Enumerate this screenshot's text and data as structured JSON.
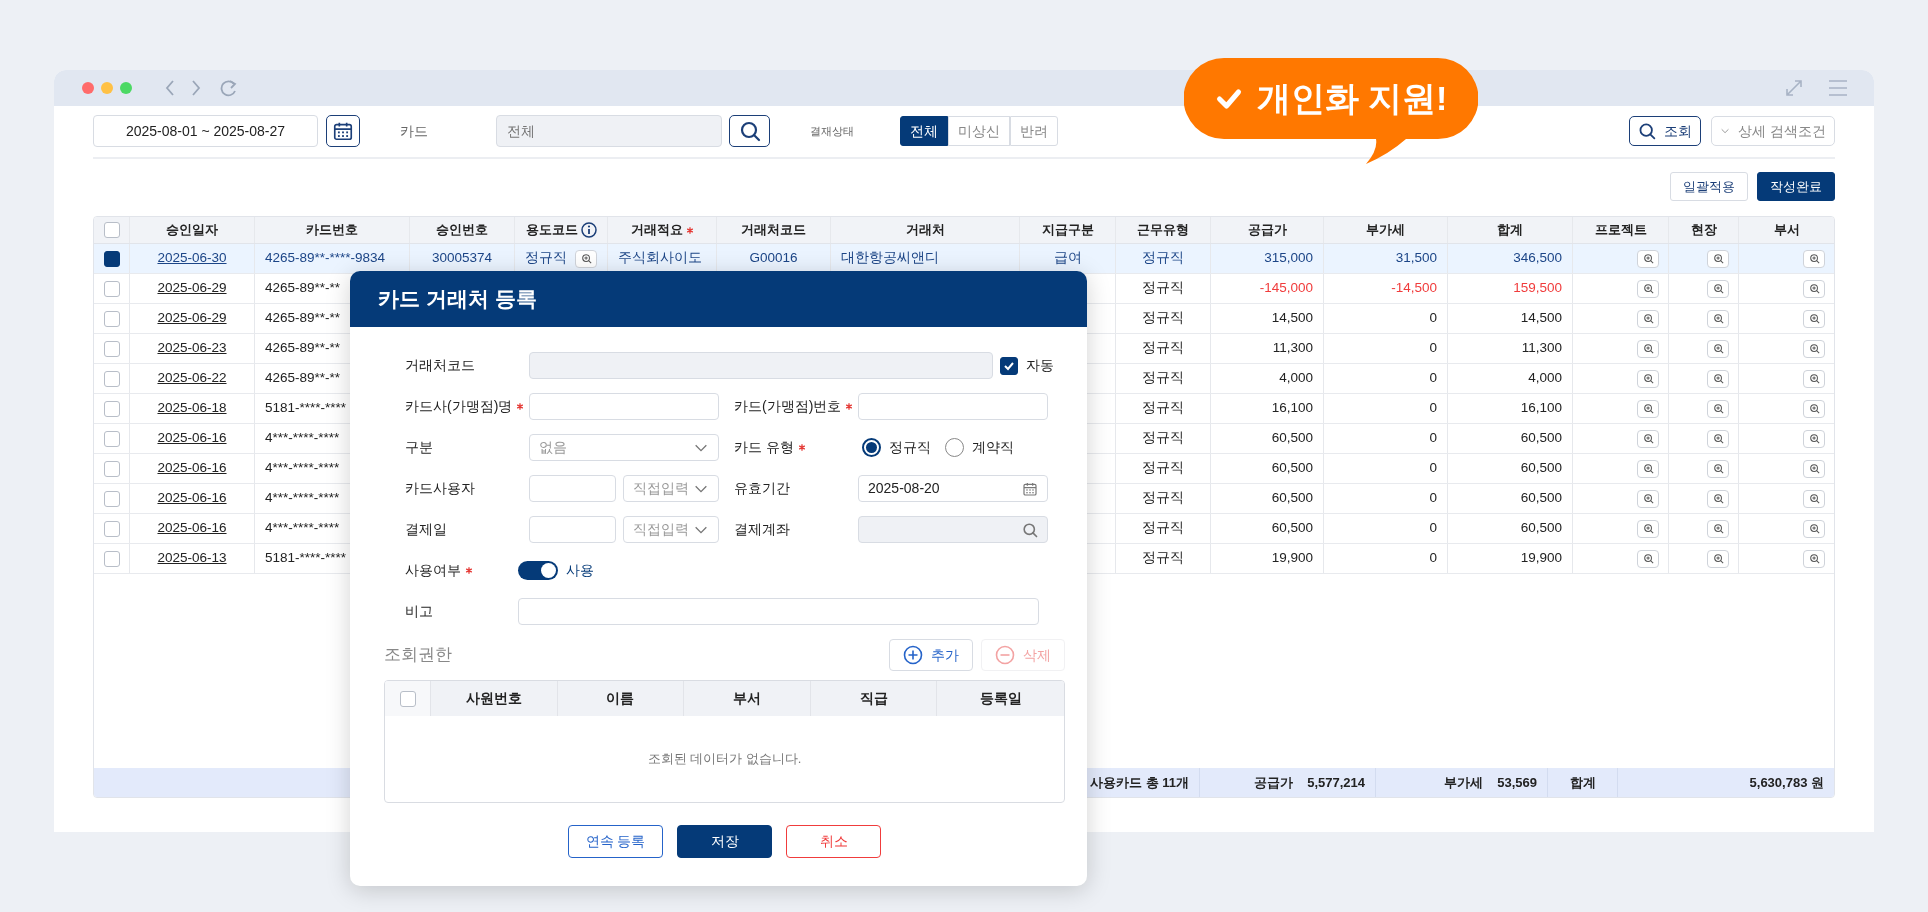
{
  "badge": {
    "text": "개인화 지원!"
  },
  "toolbar": {
    "date_range": "2025-08-01 ~ 2025-08-27",
    "card_label": "카드",
    "card_placeholder": "전체",
    "status_label": "결재상태",
    "status_options": [
      {
        "label": "전체",
        "selected": true
      },
      {
        "label": "미상신",
        "selected": false
      },
      {
        "label": "반려",
        "selected": false
      }
    ],
    "search_button": "조회",
    "detail_button": "상세 검색조건"
  },
  "actions": [
    {
      "label": "일괄적용",
      "kind": "outline"
    },
    {
      "label": "작성완료",
      "kind": "primary"
    }
  ],
  "table": {
    "header_checked": false,
    "columns": [
      {
        "label": "승인일자",
        "kind": "plain"
      },
      {
        "label": "카드번호",
        "kind": "plain"
      },
      {
        "label": "승인번호",
        "kind": "plain"
      },
      {
        "label": "용도코드",
        "kind": "info"
      },
      {
        "label": "거래적요",
        "kind": "required"
      },
      {
        "label": "거래처코드",
        "kind": "plain"
      },
      {
        "label": "거래처",
        "kind": "plain"
      },
      {
        "label": "지급구분",
        "kind": "plain"
      },
      {
        "label": "근무유형",
        "kind": "plain"
      },
      {
        "label": "공급가",
        "kind": "plain"
      },
      {
        "label": "부가세",
        "kind": "plain"
      },
      {
        "label": "합계",
        "kind": "plain"
      },
      {
        "label": "프로젝트",
        "kind": "plain"
      },
      {
        "label": "현장",
        "kind": "plain"
      },
      {
        "label": "부서",
        "kind": "plain"
      }
    ],
    "rows": [
      {
        "checked": true,
        "negative": false,
        "date": "2025-06-30",
        "card": "4265-89**-****-9834",
        "approval": "30005374",
        "purpose": "정규직",
        "summary": "주식회사이도",
        "vendor_code": "G00016",
        "vendor": "대한항공씨앤디",
        "pay_type": "급여",
        "work_type": "정규직",
        "supply": "315,000",
        "vat": "31,500",
        "total": "346,500"
      },
      {
        "checked": false,
        "negative": true,
        "date": "2025-06-29",
        "card": "4265-89**-**",
        "work_type": "정규직",
        "supply": "-145,000",
        "vat": "-14,500",
        "total": "159,500"
      },
      {
        "checked": false,
        "negative": false,
        "date": "2025-06-29",
        "card": "4265-89**-**",
        "work_type": "정규직",
        "supply": "14,500",
        "vat": "0",
        "total": "14,500"
      },
      {
        "checked": false,
        "negative": false,
        "date": "2025-06-23",
        "card": "4265-89**-**",
        "work_type": "정규직",
        "supply": "11,300",
        "vat": "0",
        "total": "11,300"
      },
      {
        "checked": false,
        "negative": false,
        "date": "2025-06-22",
        "card": "4265-89**-**",
        "work_type": "정규직",
        "supply": "4,000",
        "vat": "0",
        "total": "4,000"
      },
      {
        "checked": false,
        "negative": false,
        "date": "2025-06-18",
        "card": "5181-****-****",
        "work_type": "정규직",
        "supply": "16,100",
        "vat": "0",
        "total": "16,100"
      },
      {
        "checked": false,
        "negative": false,
        "date": "2025-06-16",
        "card": "4***-****-****",
        "work_type": "정규직",
        "supply": "60,500",
        "vat": "0",
        "total": "60,500"
      },
      {
        "checked": false,
        "negative": false,
        "date": "2025-06-16",
        "card": "4***-****-****",
        "work_type": "정규직",
        "supply": "60,500",
        "vat": "0",
        "total": "60,500"
      },
      {
        "checked": false,
        "negative": false,
        "date": "2025-06-16",
        "card": "4***-****-****",
        "work_type": "정규직",
        "supply": "60,500",
        "vat": "0",
        "total": "60,500"
      },
      {
        "checked": false,
        "negative": false,
        "date": "2025-06-16",
        "card": "4***-****-****",
        "work_type": "정규직",
        "supply": "60,500",
        "vat": "0",
        "total": "60,500"
      },
      {
        "checked": false,
        "negative": false,
        "date": "2025-06-13",
        "card": "5181-****-****",
        "work_type": "정규직",
        "supply": "19,900",
        "vat": "0",
        "total": "19,900"
      }
    ],
    "footer": {
      "count": "사용카드 총 11개",
      "supply_label": "공급가",
      "supply": "5,577,214",
      "vat_label": "부가세",
      "vat": "53,569",
      "total_label": "합계",
      "total": "5,630,783 원"
    }
  },
  "modal": {
    "title": "카드 거래처 등록",
    "vendor_code": {
      "label": "거래처코드",
      "auto_label": "자동",
      "auto_checked": true
    },
    "card_company": {
      "label": "카드사(가맹점)명",
      "required": true
    },
    "card_number": {
      "label": "카드(가맹점)번호",
      "required": true
    },
    "category": {
      "label": "구분",
      "value": "없음"
    },
    "card_type": {
      "label": "카드 유형",
      "required": true,
      "options": [
        {
          "label": "정규직",
          "selected": true
        },
        {
          "label": "계약직",
          "selected": false
        }
      ]
    },
    "card_user": {
      "label": "카드사용자",
      "mode": "직접입력"
    },
    "expiry": {
      "label": "유효기간",
      "value": "2025-08-20"
    },
    "pay_day": {
      "label": "결제일",
      "mode": "직접입력"
    },
    "pay_account": {
      "label": "결제계좌"
    },
    "active": {
      "label": "사용여부",
      "required": true,
      "on": true,
      "text": "사용"
    },
    "note": {
      "label": "비고"
    },
    "permissions": {
      "title": "조회권한",
      "add": {
        "label": "추가",
        "disabled": false
      },
      "remove": {
        "label": "삭제",
        "disabled": true
      },
      "header_checked": false,
      "columns": [
        "사원번호",
        "이름",
        "부서",
        "직급",
        "등록일"
      ],
      "empty": "조회된 데이터가 없습니다."
    },
    "buttons": [
      {
        "label": "연속 등록",
        "kind": "outline"
      },
      {
        "label": "저장",
        "kind": "primary"
      },
      {
        "label": "취소",
        "kind": "danger"
      }
    ]
  }
}
